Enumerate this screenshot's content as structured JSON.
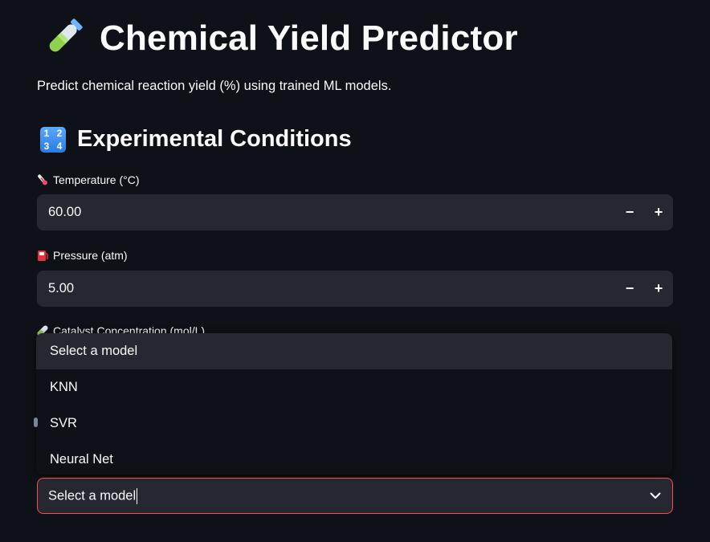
{
  "header": {
    "title": "Chemical Yield Predictor",
    "title_icon": "test-tube-icon",
    "subtitle": "Predict chemical reaction yield (%) using trained ML models."
  },
  "section": {
    "title": "Experimental Conditions",
    "icon": "input-numbers-icon",
    "icon_digits": [
      "1",
      "2",
      "3",
      "4"
    ]
  },
  "fields": [
    {
      "label": "Temperature (°C)",
      "icon": "thermometer-icon",
      "value": "60.00",
      "minus": "−",
      "plus": "+"
    },
    {
      "label": "Pressure (atm)",
      "icon": "fuel-pump-icon",
      "value": "5.00",
      "minus": "−",
      "plus": "+"
    }
  ],
  "catalyst": {
    "label": "Catalyst Concentration (mol/L)",
    "icon": "test-tube-icon"
  },
  "model_select": {
    "placeholder": "Select a model",
    "value": "Select a model",
    "options": [
      "Select a model",
      "KNN",
      "SVR",
      "Neural Net"
    ],
    "highlighted_index": 0,
    "chevron": "chevron-down-icon"
  },
  "colors": {
    "background": "#0e1117",
    "input_bg": "#262730",
    "focus_border": "#ff4b4b",
    "text": "#fafafa"
  }
}
